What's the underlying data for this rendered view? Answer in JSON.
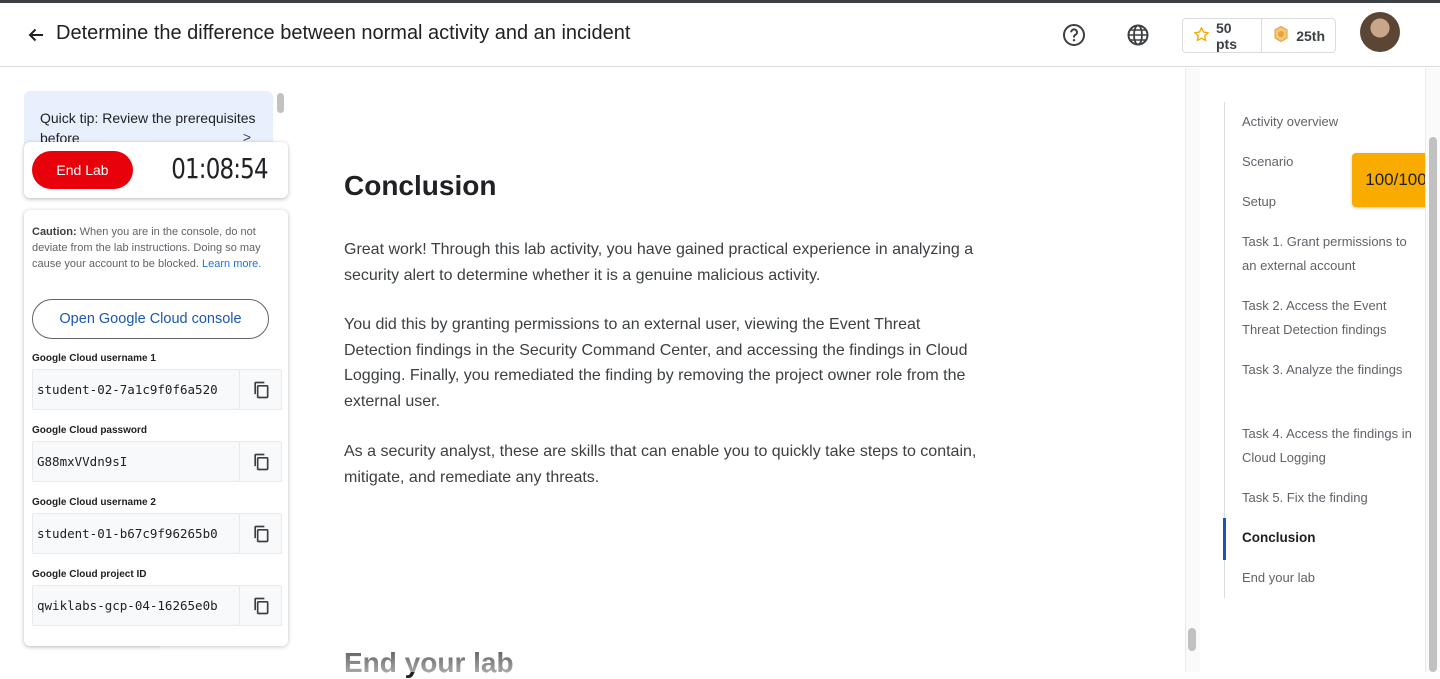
{
  "header": {
    "title": "Determine the difference between normal activity and an incident",
    "points": "50 pts",
    "rank": "25th"
  },
  "tip": {
    "text": "Quick tip: Review the prerequisites before"
  },
  "lab": {
    "end_label": "End Lab",
    "timer": "01:08:54"
  },
  "credentials": {
    "caution_bold": "Caution:",
    "caution_text": " When you are in the console, do not deviate from the lab instructions. Doing so may cause your account to be blocked. ",
    "learn_more": "Learn more.",
    "open_console": "Open Google Cloud console",
    "fields": [
      {
        "label": "Google Cloud username 1",
        "value": "student-02-7a1c9f0f6a520"
      },
      {
        "label": "Google Cloud password",
        "value": "G88mxVVdn9sI"
      },
      {
        "label": "Google Cloud username 2",
        "value": "student-01-b67c9f96265b0"
      },
      {
        "label": "Google Cloud project ID",
        "value": "qwiklabs-gcp-04-16265e0b"
      }
    ]
  },
  "content": {
    "heading": "Conclusion",
    "paragraphs": [
      "Great work! Through this lab activity, you have gained practical experience in analyzing a security alert to determine whether it is a genuine malicious activity.",
      "You did this by granting permissions to an external user, viewing the Event Threat Detection findings in the Security Command Center, and accessing the findings in Cloud Logging. Finally, you remediated the finding by removing the project owner role from the external user.",
      "As a security analyst, these are skills that can enable you to quickly take steps to contain, mitigate, and remediate any threats."
    ],
    "next_heading": "End your lab"
  },
  "toc": {
    "items": [
      "Activity overview",
      "Scenario",
      "Setup",
      "Task 1. Grant permissions to an external account",
      "Task 2. Access the Event Threat Detection findings",
      "Task 3. Analyze the findings",
      "Task 4. Access the findings in Cloud Logging",
      "Task 5. Fix the finding",
      "Conclusion",
      "End your lab"
    ],
    "active": "Conclusion"
  },
  "score": "100/100",
  "colors": {
    "end_lab": "#e8000b",
    "score_badge": "#f9ab00",
    "tip_bg": "#e8f0fe",
    "toc_active_bar": "#1a57b5",
    "link": "#1a73e8"
  }
}
